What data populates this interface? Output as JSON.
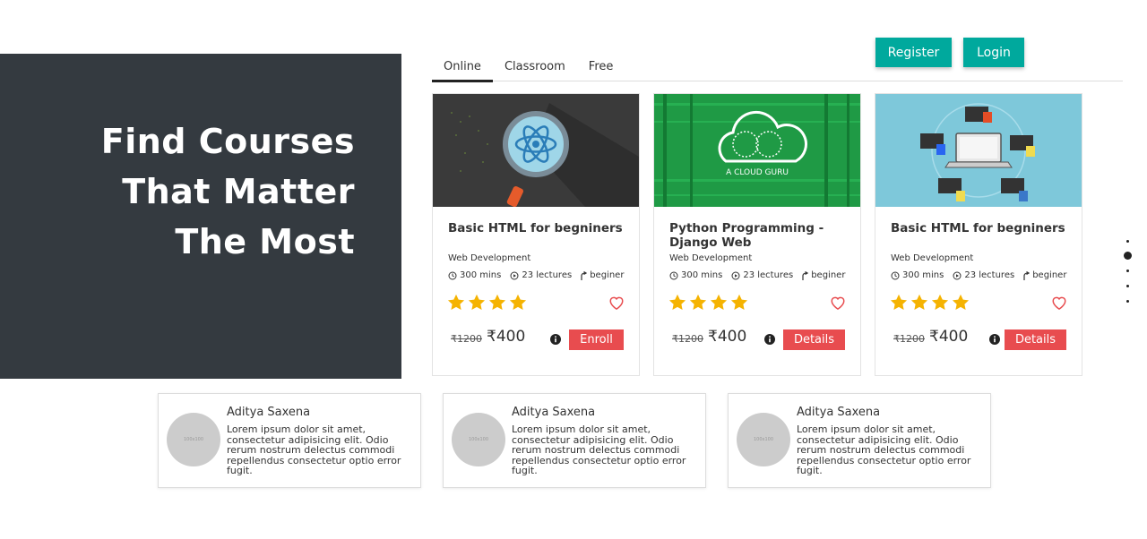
{
  "hero": {
    "line1": "Find Courses",
    "line2": "That Matter",
    "line3": "The Most"
  },
  "auth": {
    "register": "Register",
    "login": "Login"
  },
  "tabs": [
    {
      "label": "Online",
      "active": true
    },
    {
      "label": "Classroom",
      "active": false
    },
    {
      "label": "Free",
      "active": false
    }
  ],
  "courses": [
    {
      "image": "react-atom-magnifier",
      "title": "Basic HTML for begniners",
      "category": "Web Development",
      "duration": "300 mins",
      "lectures": "23 lectures",
      "level": "beginer",
      "rating": 4,
      "old_price": "₹1200",
      "price": "₹400",
      "action": "Enroll"
    },
    {
      "image": "a-cloud-guru",
      "image_text": "A CLOUD GURU",
      "title": "Python Programming - Django Web",
      "category": "Web Development",
      "duration": "300 mins",
      "lectures": "23 lectures",
      "level": "beginer",
      "rating": 4,
      "old_price": "₹1200",
      "price": "₹400",
      "action": "Details"
    },
    {
      "image": "laptop-web-tech-icons",
      "title": "Basic HTML for begniners",
      "category": "Web Development",
      "duration": "300 mins",
      "lectures": "23 lectures",
      "level": "beginer",
      "rating": 4,
      "old_price": "₹1200",
      "price": "₹400",
      "action": "Details"
    }
  ],
  "carousel": {
    "count": 5,
    "active_index": 1
  },
  "testimonials": [
    {
      "name": "Aditya Saxena",
      "avatar_text": "100x100",
      "text": "Lorem ipsum dolor sit amet, consectetur adipisicing elit. Odio rerum nostrum delectus commodi repellendus consectetur optio error fugit."
    },
    {
      "name": "Aditya Saxena",
      "avatar_text": "100x100",
      "text": "Lorem ipsum dolor sit amet, consectetur adipisicing elit. Odio rerum nostrum delectus commodi repellendus consectetur optio error fugit."
    },
    {
      "name": "Aditya Saxena",
      "avatar_text": "100x100",
      "text": "Lorem ipsum dolor sit amet, consectetur adipisicing elit. Odio rerum nostrum delectus commodi repellendus consectetur optio error fugit."
    }
  ],
  "colors": {
    "hero_bg": "#343a40",
    "teal": "#00a99d",
    "red": "#e84c4f",
    "star": "#f5b301"
  }
}
